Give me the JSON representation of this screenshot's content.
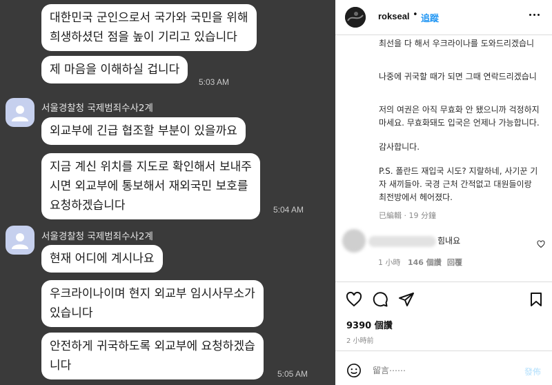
{
  "chat": {
    "messages": [
      {
        "lines": [
          "대한민국 군인으로서 국가와 국민을 위해",
          "희생하셨던 점을 높이 기리고 있습니다"
        ]
      },
      {
        "lines": [
          "제 마음을 이해하실 겁니다"
        ],
        "time": "5:03 AM"
      },
      {
        "sender": "서울경찰청 국제범죄수사2계"
      },
      {
        "lines": [
          "외교부에 긴급 협조할 부분이 있을까요"
        ]
      },
      {
        "lines": [
          "지금 계신 위치를 지도로 확인해서 보내주",
          "시면 외교부에 통보해서 재외국민 보호를",
          "요청하겠습니다"
        ],
        "time": "5:04 AM"
      },
      {
        "sender": "서울경찰청 국제범죄수사2계"
      },
      {
        "lines": [
          "현재 어디에 계시나요"
        ]
      },
      {
        "lines": [
          "우크라이나이며 현지 외교부 임시사무소가",
          "있습니다"
        ]
      },
      {
        "lines": [
          "안전하게 귀국하도록 외교부에 요청하겠습",
          "니다"
        ],
        "time": "5:05 AM"
      }
    ]
  },
  "post": {
    "username": "rokseal",
    "separator": "•",
    "follow_label": "追蹤",
    "more_icon": "more-horizontal-icon",
    "caption": [
      "최선을 다 해서 우크라이나를 도와드리겠습니",
      "나중에 귀국할 때가 되면 그때 연락드리겠습니",
      "저의 여권은 아직 무효화 안 됐으니까 걱정하지",
      "마세요. 무효화돼도 입국은 언제나 가능합니다.",
      "감사합니다.",
      "P.S. 폴란드 재입국 시도? 지랄하네, 사기꾼 기",
      "자 새끼들아. 국경 근처 간적없고 대원들이랑",
      "최전방에서 헤어졌다."
    ],
    "edited_label": "已編輯",
    "edited_sep": "·",
    "edited_time": "19 分鐘",
    "comment": {
      "text": "힘내요",
      "time": "1 小時",
      "likes": "146 個讚",
      "reply": "回覆"
    },
    "likes_count": "9390 個讚",
    "posted_time": "2 小時前",
    "comment_placeholder": "留言⋯⋯",
    "post_button": "發佈"
  },
  "colors": {
    "chat_bg": "#3a3a3a",
    "bubble": "#ffffff",
    "avatar": "#c6d0ee",
    "follow_link": "#2196f3",
    "post_button_disabled": "#b2dffc"
  }
}
